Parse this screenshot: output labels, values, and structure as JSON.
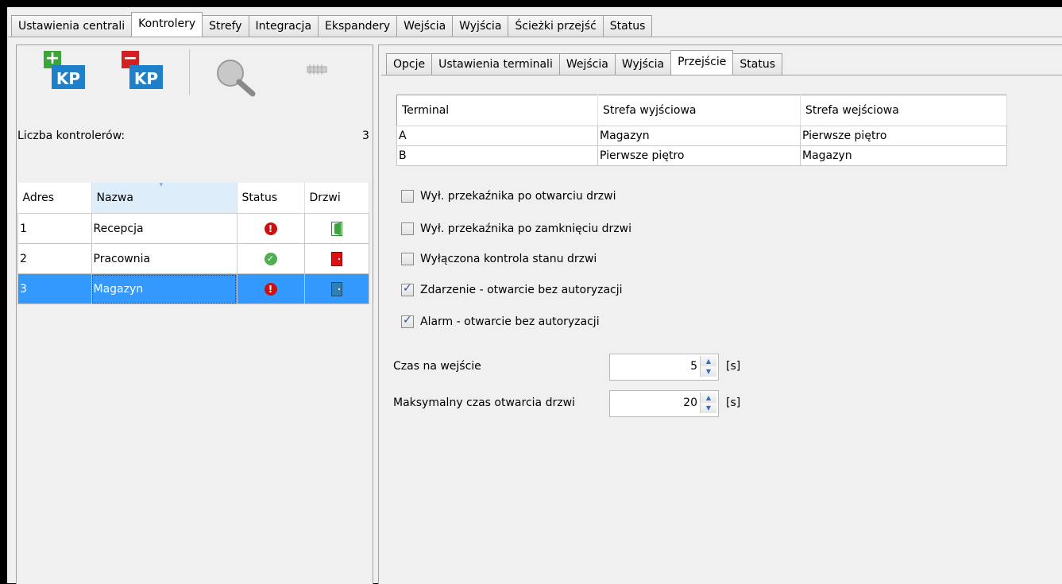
{
  "top_tabs": [
    {
      "label": "Ustawienia centrali",
      "active": false
    },
    {
      "label": "Kontrolery",
      "active": true
    },
    {
      "label": "Strefy",
      "active": false
    },
    {
      "label": "Integracja",
      "active": false
    },
    {
      "label": "Ekspandery",
      "active": false
    },
    {
      "label": "Wejścia",
      "active": false
    },
    {
      "label": "Wyjścia",
      "active": false
    },
    {
      "label": "Ścieżki przejść",
      "active": false
    },
    {
      "label": "Status",
      "active": false
    }
  ],
  "left": {
    "toolbar": {
      "add_label": "KP",
      "remove_label": "KP",
      "add_sign": "+",
      "remove_sign": "−"
    },
    "count_label": "Liczba kontrolerów:",
    "count_value": "3",
    "table": {
      "headers": [
        "Adres",
        "Nazwa",
        "Status",
        "Drzwi"
      ],
      "rows": [
        {
          "adres": "1",
          "nazwa": "Recepcja",
          "status": "error",
          "door": "open-green",
          "selected": false
        },
        {
          "adres": "2",
          "nazwa": "Pracownia",
          "status": "ok",
          "door": "closed-red",
          "selected": false
        },
        {
          "adres": "3",
          "nazwa": "Magazyn",
          "status": "error",
          "door": "closed-blue",
          "selected": true
        }
      ]
    }
  },
  "right": {
    "sub_tabs": [
      {
        "label": "Opcje",
        "active": false
      },
      {
        "label": "Ustawienia terminali",
        "active": false
      },
      {
        "label": "Wejścia",
        "active": false
      },
      {
        "label": "Wyjścia",
        "active": false
      },
      {
        "label": "Przejście",
        "active": true
      },
      {
        "label": "Status",
        "active": false
      }
    ],
    "table": {
      "headers": [
        "Terminal",
        "Strefa wyjściowa",
        "Strefa wejściowa"
      ],
      "rows": [
        [
          "A",
          "Magazyn",
          "Pierwsze piętro"
        ],
        [
          "B",
          "Pierwsze piętro",
          "Magazyn"
        ]
      ]
    },
    "checkboxes": [
      {
        "label": "Wył. przekaźnika po otwarciu drzwi",
        "checked": false
      },
      {
        "label": "Wył. przekaźnika po zamknięciu drzwi",
        "checked": false
      },
      {
        "label": "Wyłączona kontrola stanu drzwi",
        "checked": false
      },
      {
        "label": "Zdarzenie - otwarcie bez autoryzacji",
        "checked": true
      },
      {
        "label": "Alarm - otwarcie bez autoryzacji",
        "checked": true
      }
    ],
    "fields": {
      "entry_time_label": "Czas na wejście",
      "entry_time_value": "5",
      "max_open_label": "Maksymalny czas otwarcia drzwi",
      "max_open_value": "20",
      "unit": "[s]"
    }
  },
  "colors": {
    "selection": "#3399ff",
    "error": "#cc1111",
    "ok": "#4caf50",
    "kp_blue": "#1f7fc9",
    "add_green": "#3aa63a",
    "remove_red": "#d42020"
  }
}
